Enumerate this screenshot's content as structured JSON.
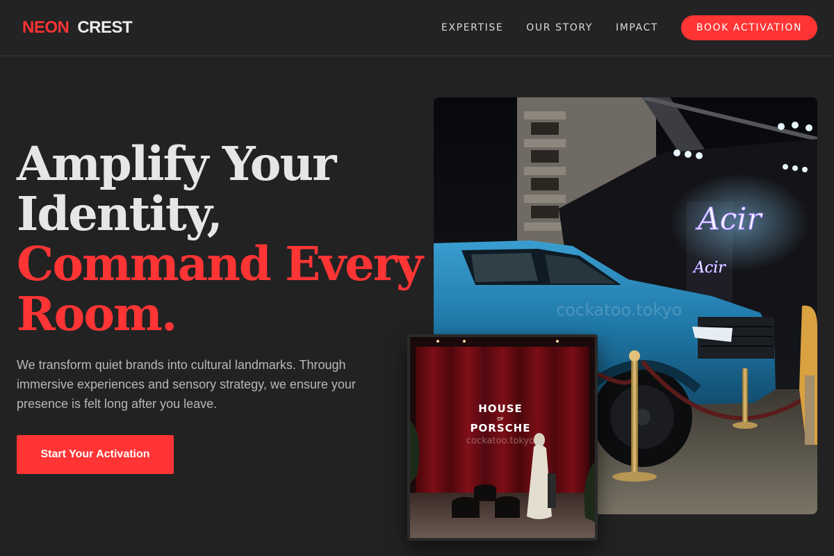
{
  "brand": {
    "word1": "NEON",
    "word2": "CREST"
  },
  "nav": {
    "items": [
      "EXPERTISE",
      "OUR STORY",
      "IMPACT"
    ],
    "cta_label": "BOOK ACTIVATION"
  },
  "hero": {
    "line1": "Amplify Your",
    "line2": "Identity,",
    "line3": "Command Every",
    "line4": "Room.",
    "description": "We transform quiet brands into cultural landmarks. Through immersive experiences and sensory strategy, we ensure your presence is felt long after you leave.",
    "button_label": "Start Your Activation"
  },
  "images": {
    "main": {
      "neon_text": "Acir",
      "watermark": "cockatoo.tokyo"
    },
    "inset": {
      "sign_line1": "HOUSE",
      "sign_line2": "OF",
      "sign_line3": "PORSCHE",
      "watermark": "cockatoo.tokyo"
    }
  },
  "colors": {
    "accent": "#ff3434",
    "background": "#222223",
    "text_muted": "#b8b8b8"
  }
}
